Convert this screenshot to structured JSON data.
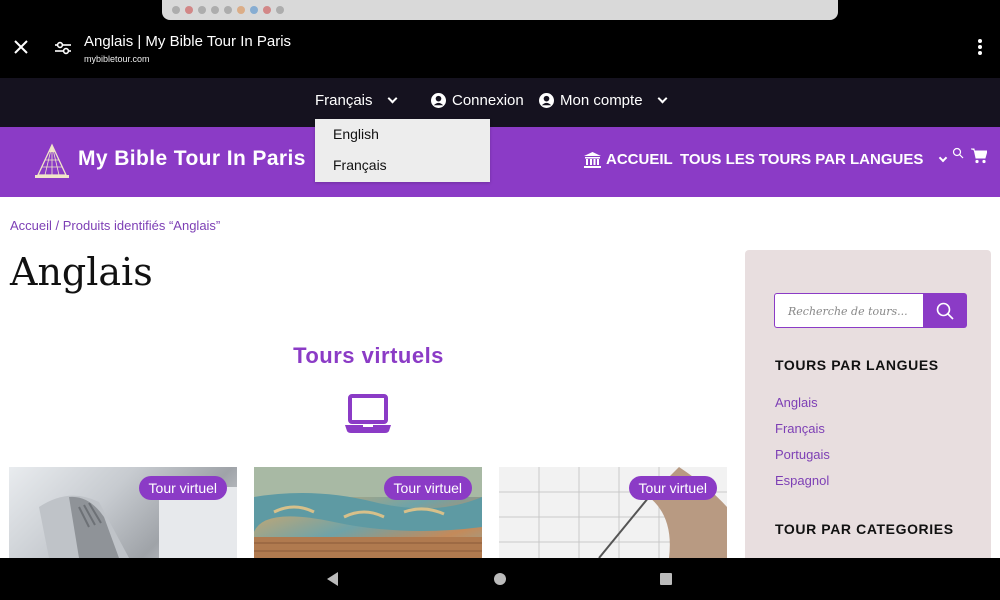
{
  "browser": {
    "title": "Anglais | My Bible Tour In Paris",
    "url": "mybibletour.com"
  },
  "topnav": {
    "language": "Français",
    "login": "Connexion",
    "account": "Mon compte"
  },
  "language_dropdown": {
    "options": [
      "English",
      "Français"
    ]
  },
  "header": {
    "brand": "My Bible Tour In Paris",
    "nav_home": "ACCUEIL",
    "nav_tours": "TOUS LES TOURS PAR LANGUES"
  },
  "breadcrumb": "Accueil / Produits identifiés “Anglais”",
  "page_title": "Anglais",
  "section_title": "Tours virtuels",
  "cards": [
    {
      "badge": "Tour virtuel"
    },
    {
      "badge": "Tour virtuel"
    },
    {
      "badge": "Tour virtuel"
    }
  ],
  "sidebar": {
    "search_placeholder": "Recherche de tours...",
    "heading_languages": "TOURS PAR LANGUES",
    "languages": [
      "Anglais",
      "Français",
      "Portugais",
      "Espagnol"
    ],
    "heading_categories": "TOUR PAR CATEGORIES"
  },
  "colors": {
    "brand_purple": "#8b3bc6",
    "topnav_dark": "#15121f",
    "sidebar_bg": "#e8dedf"
  }
}
